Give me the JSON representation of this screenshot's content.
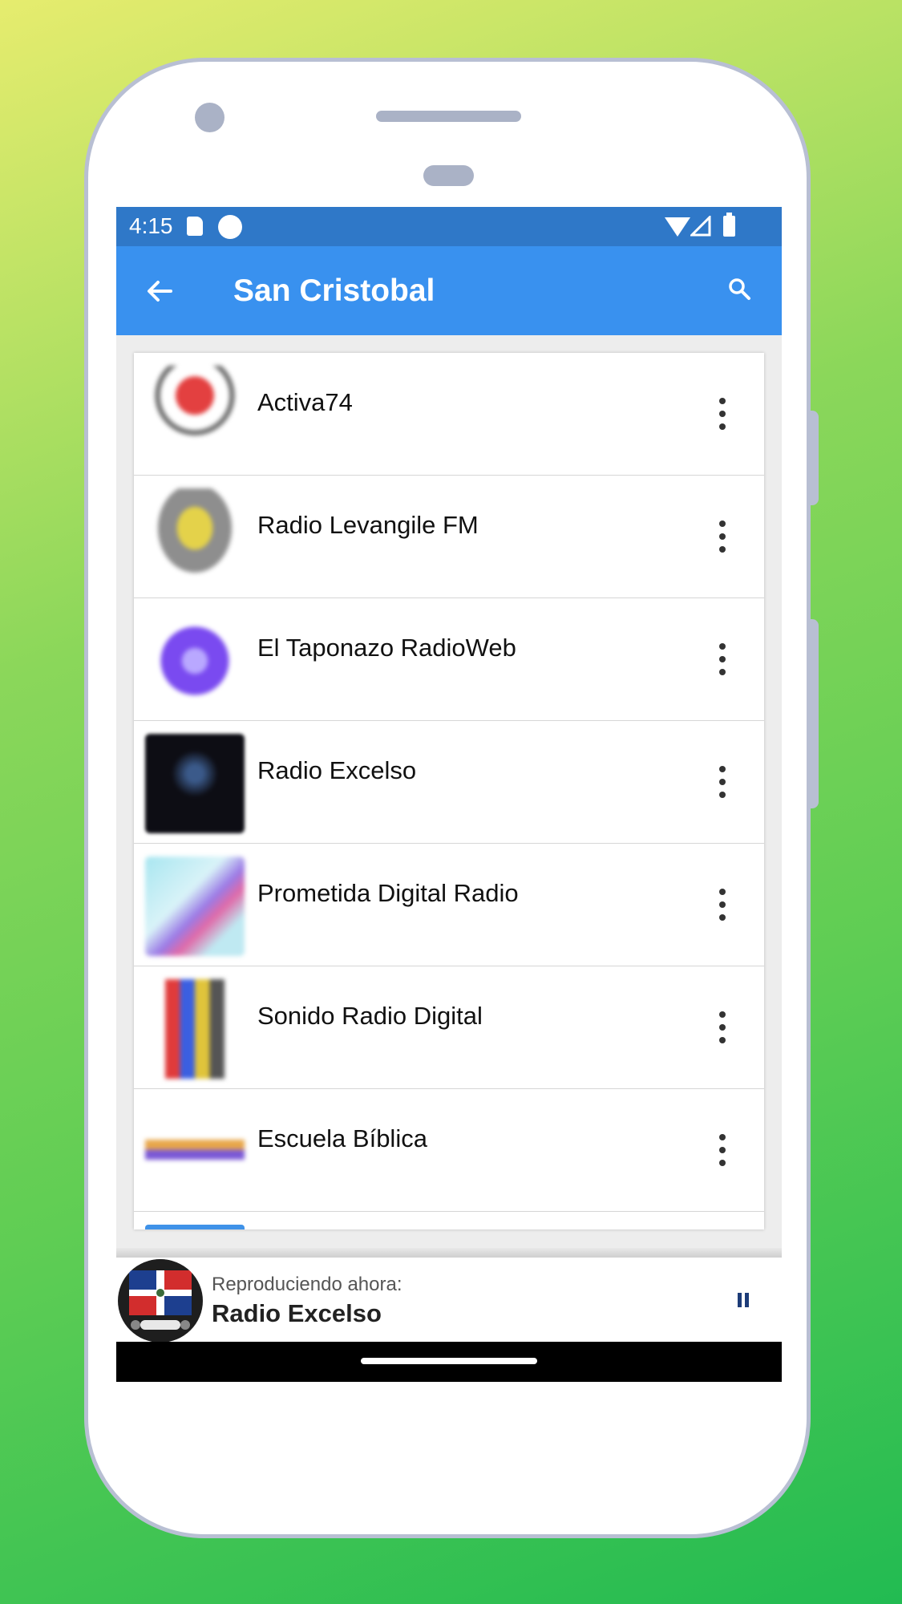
{
  "status_bar": {
    "time": "4:15"
  },
  "app_bar": {
    "title": "San Cristobal"
  },
  "stations": [
    {
      "name": "Activa74"
    },
    {
      "name": "Radio Levangile FM"
    },
    {
      "name": "El Taponazo RadioWeb"
    },
    {
      "name": "Radio Excelso"
    },
    {
      "name": "Prometida Digital Radio"
    },
    {
      "name": "Sonido Radio Digital"
    },
    {
      "name": "Escuela Bíblica"
    }
  ],
  "now_playing": {
    "label": "Reproduciendo ahora:",
    "station": "Radio Excelso"
  },
  "colors": {
    "status_bar": "#2f78c8",
    "app_bar": "#3991ef",
    "pause": "#1d3c78"
  },
  "icons": [
    "sd-card-icon",
    "circle-icon",
    "wifi-icon",
    "cell-signal-icon",
    "battery-icon",
    "back-arrow-icon",
    "search-icon",
    "more-vert-icon",
    "pause-icon"
  ]
}
